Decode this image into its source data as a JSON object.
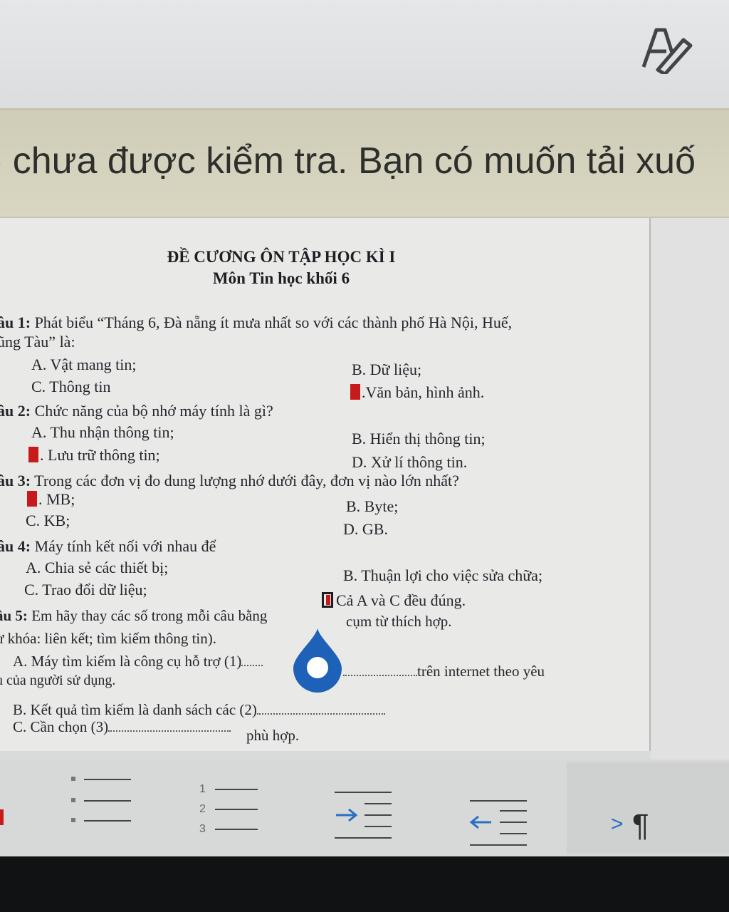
{
  "banner": {
    "text": ") chưa được kiểm tra. Bạn có muốn tải xuố"
  },
  "document": {
    "title": "ĐỀ CƯƠNG ÔN TẬP HỌC KÌ I",
    "subtitle": "Môn Tin học khối 6",
    "q1": {
      "label": "âu 1:",
      "text": " Phát biểu “Tháng 6, Đà nẵng ít mưa nhất so với các thành phố Hà Nội, Huế,",
      "cont": "ũng Tàu” là:",
      "a": "A. Vật mang tin;",
      "b": "B. Dữ liệu;",
      "c": "C. Thông tin",
      "d": ".Văn bản, hình ảnh."
    },
    "q2": {
      "label": "âu 2:",
      "text": " Chức năng của bộ  nhớ máy tính là gì?",
      "a": "A. Thu nhận thông tin;",
      "b": "B. Hiển thị thông tin;",
      "c": ". Lưu trữ thông tin;",
      "d": "D. Xử lí thông tin."
    },
    "q3": {
      "label": "âu 3:",
      "text": " Trong các đơn vị đo dung lượng nhớ dưới đây, đơn vị nào lớn nhất?",
      "a": ". MB;",
      "b": "B. Byte;",
      "c": "C. KB;",
      "d": "D. GB."
    },
    "q4": {
      "label": "âu 4:",
      "text": " Máy tính kết nối với nhau để",
      "a": "A. Chia sẻ các thiết bị;",
      "b": "B. Thuận lợi cho việc sửa chữa;",
      "c": "C. Trao đổi dữ liệu;",
      "d": "Cả A và C đều đúng."
    },
    "q5": {
      "label": "âu 5:",
      "text": " Em hãy thay các số trong mỗi câu bằng",
      "text_end": "cụm từ thích hợp.",
      "keywords": "ừ khóa: liên kết; tìm kiếm thông tin).",
      "a_start": "A. Máy tìm kiếm là công cụ hỗ trợ (1)",
      "a_end": "trên internet theo yêu",
      "a_cont": "u của người sử dụng.",
      "b": "B. Kết quả tìm kiếm là danh sách các (2)",
      "c_start": "C. Cần chọn (3)",
      "c_end": "phù hợp."
    }
  },
  "toolbar": {
    "buttons": [
      "bullet-list",
      "numbered-list",
      "increase-indent",
      "decrease-indent"
    ],
    "numbers": [
      "1",
      "2",
      "3"
    ],
    "paragraph_symbol": "¶",
    "more_chevron": ">"
  }
}
